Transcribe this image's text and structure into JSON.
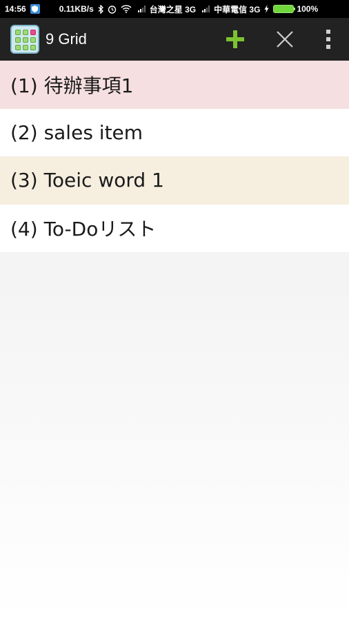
{
  "status_bar": {
    "time": "14:56",
    "net_speed": "0.11KB/s",
    "carrier1": "台灣之星 3G",
    "carrier2": "中華電信 3G",
    "battery": "100%"
  },
  "action_bar": {
    "title": "9 Grid",
    "add_icon": "plus-icon",
    "close_icon": "close-icon",
    "overflow_icon": "more-vert-icon",
    "accent_color": "#7dc232"
  },
  "list": {
    "items": [
      {
        "label": "(1) 待辦事項1",
        "color": "#f6dfe0"
      },
      {
        "label": "(2) sales item",
        "color": "#ffffff"
      },
      {
        "label": "(3) Toeic word 1",
        "color": "#f6eedf"
      },
      {
        "label": "(4) To-Doリスト",
        "color": "#ffffff"
      }
    ]
  }
}
